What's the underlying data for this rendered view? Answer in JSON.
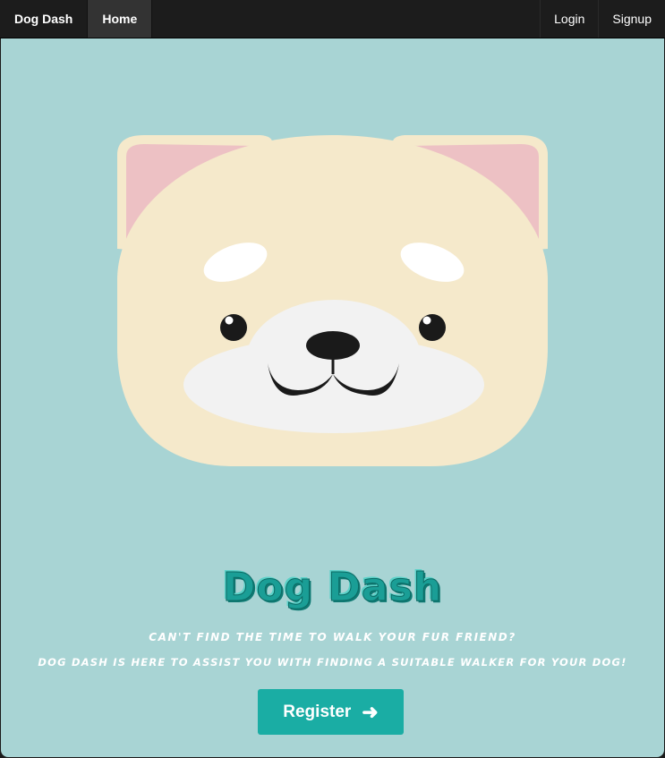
{
  "navbar": {
    "brand": "Dog Dash",
    "home_label": "Home",
    "login_label": "Login",
    "signup_label": "Signup"
  },
  "hero": {
    "title": "Dog Dash",
    "tagline_1": "Can't find the time to walk your fur friend?",
    "tagline_2": "Dog Dash is here to assist you with finding a suitable walker for your dog!",
    "register_label": "Register",
    "register_icon": "arrow-right-icon"
  },
  "colors": {
    "navbar_bg": "#1c1c1c",
    "hero_bg": "#a8d4d4",
    "accent": "#1aada4",
    "dog_face": "#f5e9cb",
    "dog_ear_inner": "#edc1c4",
    "dog_muzzle": "#f2f2f2"
  }
}
